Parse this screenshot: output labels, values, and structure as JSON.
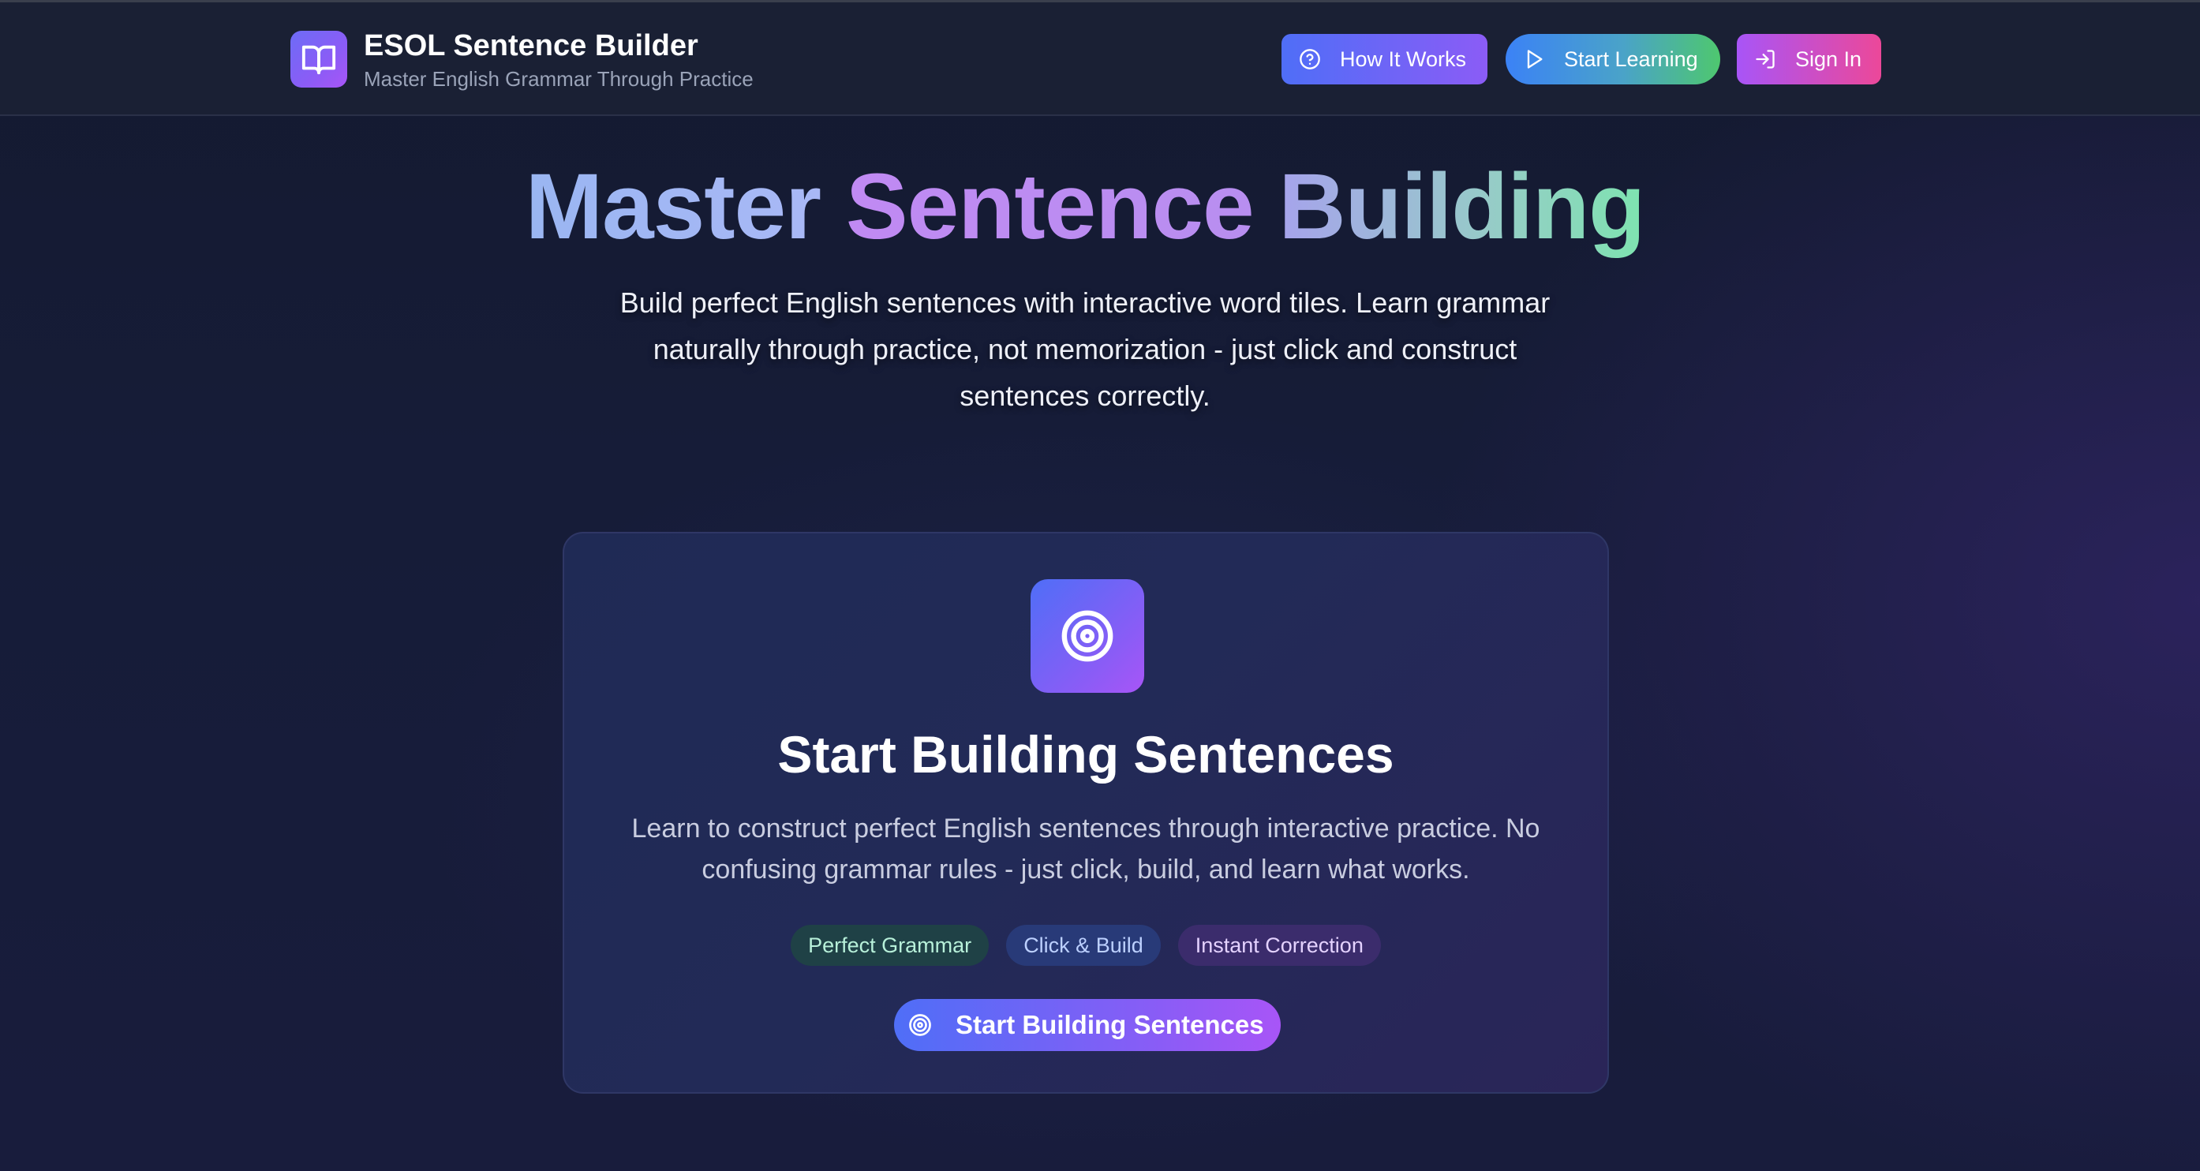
{
  "header": {
    "app_title": "ESOL Sentence Builder",
    "app_subtitle": "Master English Grammar Through Practice",
    "logo_icon": "book-open-icon",
    "nav": [
      {
        "label": "How It Works",
        "icon": "help-circle-icon"
      },
      {
        "label": "Start Learning",
        "icon": "play-icon"
      },
      {
        "label": "Sign In",
        "icon": "log-in-icon"
      }
    ]
  },
  "hero": {
    "title_part1": "Master",
    "title_part2": "Sentence",
    "title_part3": "Building",
    "description": "Build perfect English sentences with interactive word tiles. Learn grammar naturally through practice, not memorization - just click and construct sentences correctly."
  },
  "card": {
    "icon": "target-icon",
    "title": "Start Building Sentences",
    "description": "Learn to construct perfect English sentences through interactive practice. No confusing grammar rules - just click, build, and learn what works.",
    "tags": [
      "Perfect Grammar",
      "Click & Build",
      "Instant Correction"
    ],
    "cta_label": "Start Building Sentences",
    "cta_icon": "target-icon"
  },
  "colors": {
    "background": "#161c38",
    "header_bg": "#1a2034",
    "accent_blue": "#4f6ef7",
    "accent_purple": "#8b5cf6",
    "accent_green": "#4ec76f",
    "accent_pink": "#ec4899"
  }
}
